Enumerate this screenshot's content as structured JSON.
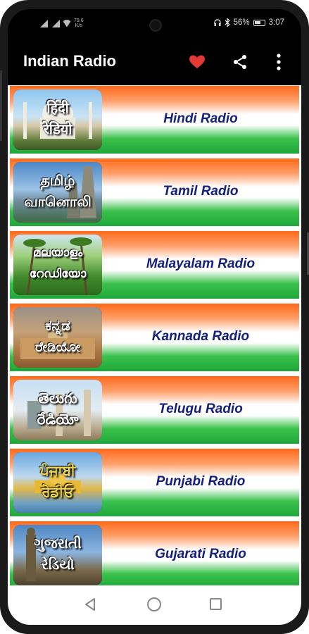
{
  "status_bar": {
    "network_speed_top": "79.6",
    "network_speed_bottom": "K/s",
    "battery": "56%",
    "time": "3:07"
  },
  "toolbar": {
    "title": "Indian Radio",
    "icons": [
      "heart-icon",
      "share-icon",
      "more-vert-icon"
    ],
    "heart_color": "#e53935"
  },
  "colors": {
    "saffron": "#ff6a1a",
    "green": "#1fa83a",
    "label": "#14207a"
  },
  "stations": [
    {
      "label": "Hindi Radio",
      "thumb_line1": "हिंदी",
      "thumb_line2": "रेडियो"
    },
    {
      "label": "Tamil Radio",
      "thumb_line1": "தமிழ்",
      "thumb_line2": "வானொலி"
    },
    {
      "label": "Malayalam Radio",
      "thumb_line1": "മലയാളം",
      "thumb_line2": "റേഡിയോ"
    },
    {
      "label": "Kannada Radio",
      "thumb_line1": "ಕನ್ನಡ",
      "thumb_line2": "ರೇಡಿಯೋ"
    },
    {
      "label": "Telugu Radio",
      "thumb_line1": "తెలుగు",
      "thumb_line2": "రేడియో"
    },
    {
      "label": "Punjabi Radio",
      "thumb_line1": "ਪੰਜਾਬੀ",
      "thumb_line2": "ਰੇਡੀਓ"
    },
    {
      "label": "Gujarati Radio",
      "thumb_line1": "ગુજરાતી",
      "thumb_line2": "રેડિયો"
    }
  ],
  "nav_bar": {
    "icons": [
      "back-icon",
      "home-icon",
      "recents-icon"
    ]
  }
}
